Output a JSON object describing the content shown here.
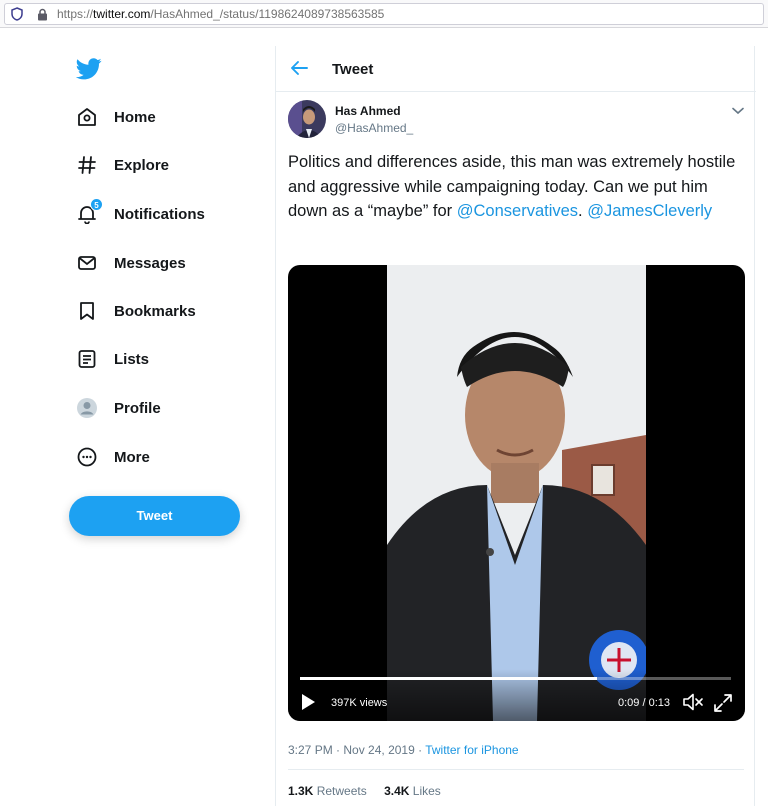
{
  "browser": {
    "url_prefix": "https://",
    "url_host": "twitter.com",
    "url_path": "/HasAhmed_/status/1198624089738563585"
  },
  "sidebar": {
    "items": [
      {
        "label": "Home",
        "icon": "home-icon"
      },
      {
        "label": "Explore",
        "icon": "hashtag-icon"
      },
      {
        "label": "Notifications",
        "icon": "bell-icon",
        "badge": "5"
      },
      {
        "label": "Messages",
        "icon": "envelope-icon"
      },
      {
        "label": "Bookmarks",
        "icon": "bookmark-icon"
      },
      {
        "label": "Lists",
        "icon": "list-icon"
      },
      {
        "label": "Profile",
        "icon": "profile-icon"
      },
      {
        "label": "More",
        "icon": "more-icon"
      }
    ],
    "tweet_button": "Tweet"
  },
  "header": {
    "title": "Tweet"
  },
  "tweet": {
    "author_name": "Has Ahmed",
    "author_handle": "@HasAhmed_",
    "text_part1": "Politics and differences aside, this man was extremely hostile and aggressive while campaigning today. Can we put him down as a “maybe” for ",
    "mention1": "@Conservatives",
    "text_part2": ". ",
    "mention2": "@JamesCleverly",
    "video": {
      "views": "397K views",
      "current_time": "0:09",
      "duration": "0:13",
      "progress": 0.69
    },
    "time": "3:27 PM",
    "date": "Nov 24, 2019",
    "client": "Twitter for iPhone",
    "retweets": "1.3K",
    "retweets_label": "Retweets",
    "likes": "3.4K",
    "likes_label": "Likes"
  },
  "colors": {
    "accent": "#1da1f2",
    "link": "#1b95e0",
    "secondary_text": "#657786"
  }
}
